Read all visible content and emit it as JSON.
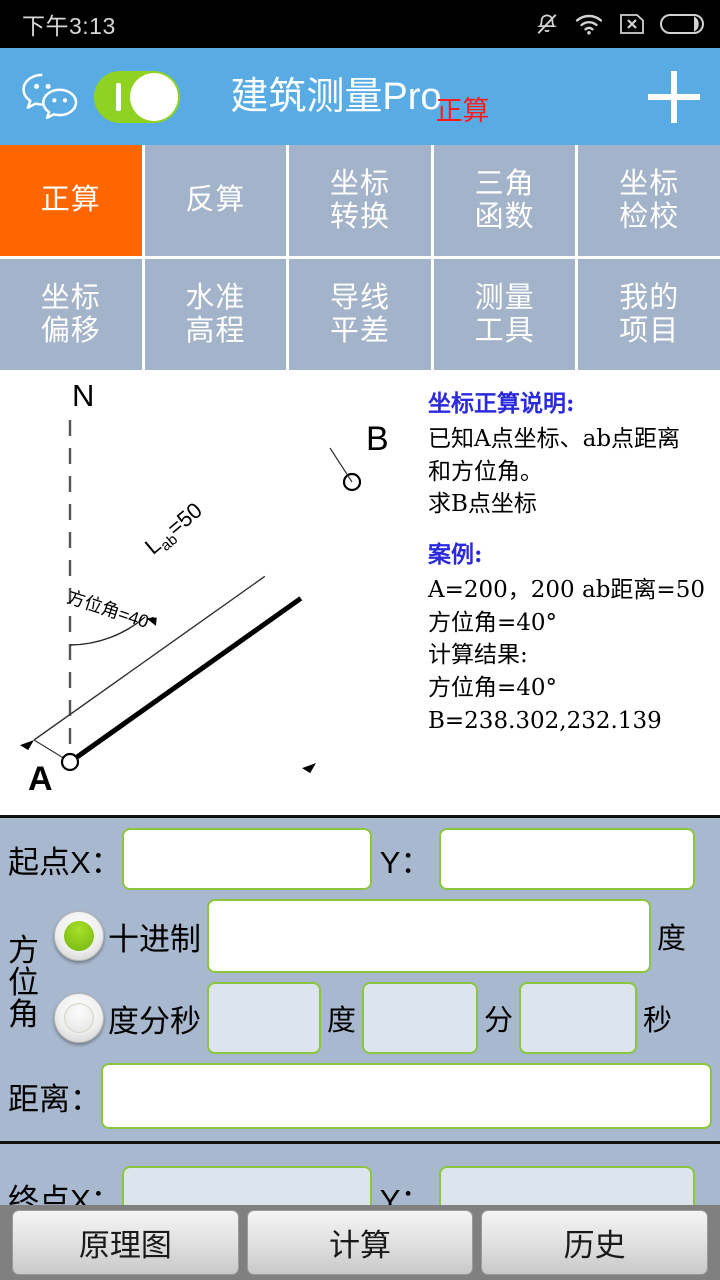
{
  "statusbar": {
    "time": "下午3:13",
    "icons": [
      "bell-muted-icon",
      "wifi-icon",
      "no-sim-icon",
      "battery-icon"
    ]
  },
  "header": {
    "logo": "wechat-logo",
    "toggle_state": "on",
    "title": "建筑测量Pro",
    "subtitle": "正算",
    "add_label": "plus-icon",
    "background": "#58ace3"
  },
  "nav": {
    "active_index": 0,
    "active_color": "#ff6600",
    "tile_color": "#a3b3c9",
    "items": [
      {
        "line1": "正算",
        "line2": ""
      },
      {
        "line1": "反算",
        "line2": ""
      },
      {
        "line1": "坐标",
        "line2": "转换"
      },
      {
        "line1": "三角",
        "line2": "函数"
      },
      {
        "line1": "坐标",
        "line2": "检校"
      },
      {
        "line1": "坐标",
        "line2": "偏移"
      },
      {
        "line1": "水准",
        "line2": "高程"
      },
      {
        "line1": "导线",
        "line2": "平差"
      },
      {
        "line1": "测量",
        "line2": "工具"
      },
      {
        "line1": "我的",
        "line2": "项目"
      }
    ]
  },
  "diagram": {
    "north_label": "N",
    "point_a_label": "A",
    "point_b_label": "B",
    "distance_label": "L",
    "distance_sub": "ab",
    "distance_value": "=50",
    "angle_label": "方位角=40°"
  },
  "description": {
    "heading1": "坐标正算说明:",
    "line1": "已知A点坐标、ab点距离",
    "line2": "和方位角。",
    "line3": "求B点坐标",
    "heading2": "案例:",
    "line4": "A=200，200  ab距离=50",
    "line5": "方位角=40°",
    "line6": "计算结果:",
    "line7": "方位角=40°",
    "line8": "B=238.302,232.139"
  },
  "form": {
    "start_x_label": "起点X：",
    "start_y_label": "Y：",
    "start_x_value": "",
    "start_y_value": "",
    "azimuth_label_c1": "方",
    "azimuth_label_c2": "位",
    "azimuth_label_c3": "角",
    "decimal_radio_label": "十进制",
    "decimal_radio_selected": true,
    "decimal_value": "",
    "decimal_unit": "度",
    "dms_radio_label": "度分秒",
    "dms_radio_selected": false,
    "dms_degree_value": "",
    "dms_degree_unit": "度",
    "dms_minute_value": "",
    "dms_minute_unit": "分",
    "dms_second_value": "",
    "dms_second_unit": "秒",
    "distance_label": "距离：",
    "distance_value": "",
    "end_x_label": "终点X：",
    "end_y_label": "Y：",
    "end_x_value": "",
    "end_y_value": ""
  },
  "buttons": {
    "diagram": "原理图",
    "calculate": "计算",
    "history": "历史"
  }
}
